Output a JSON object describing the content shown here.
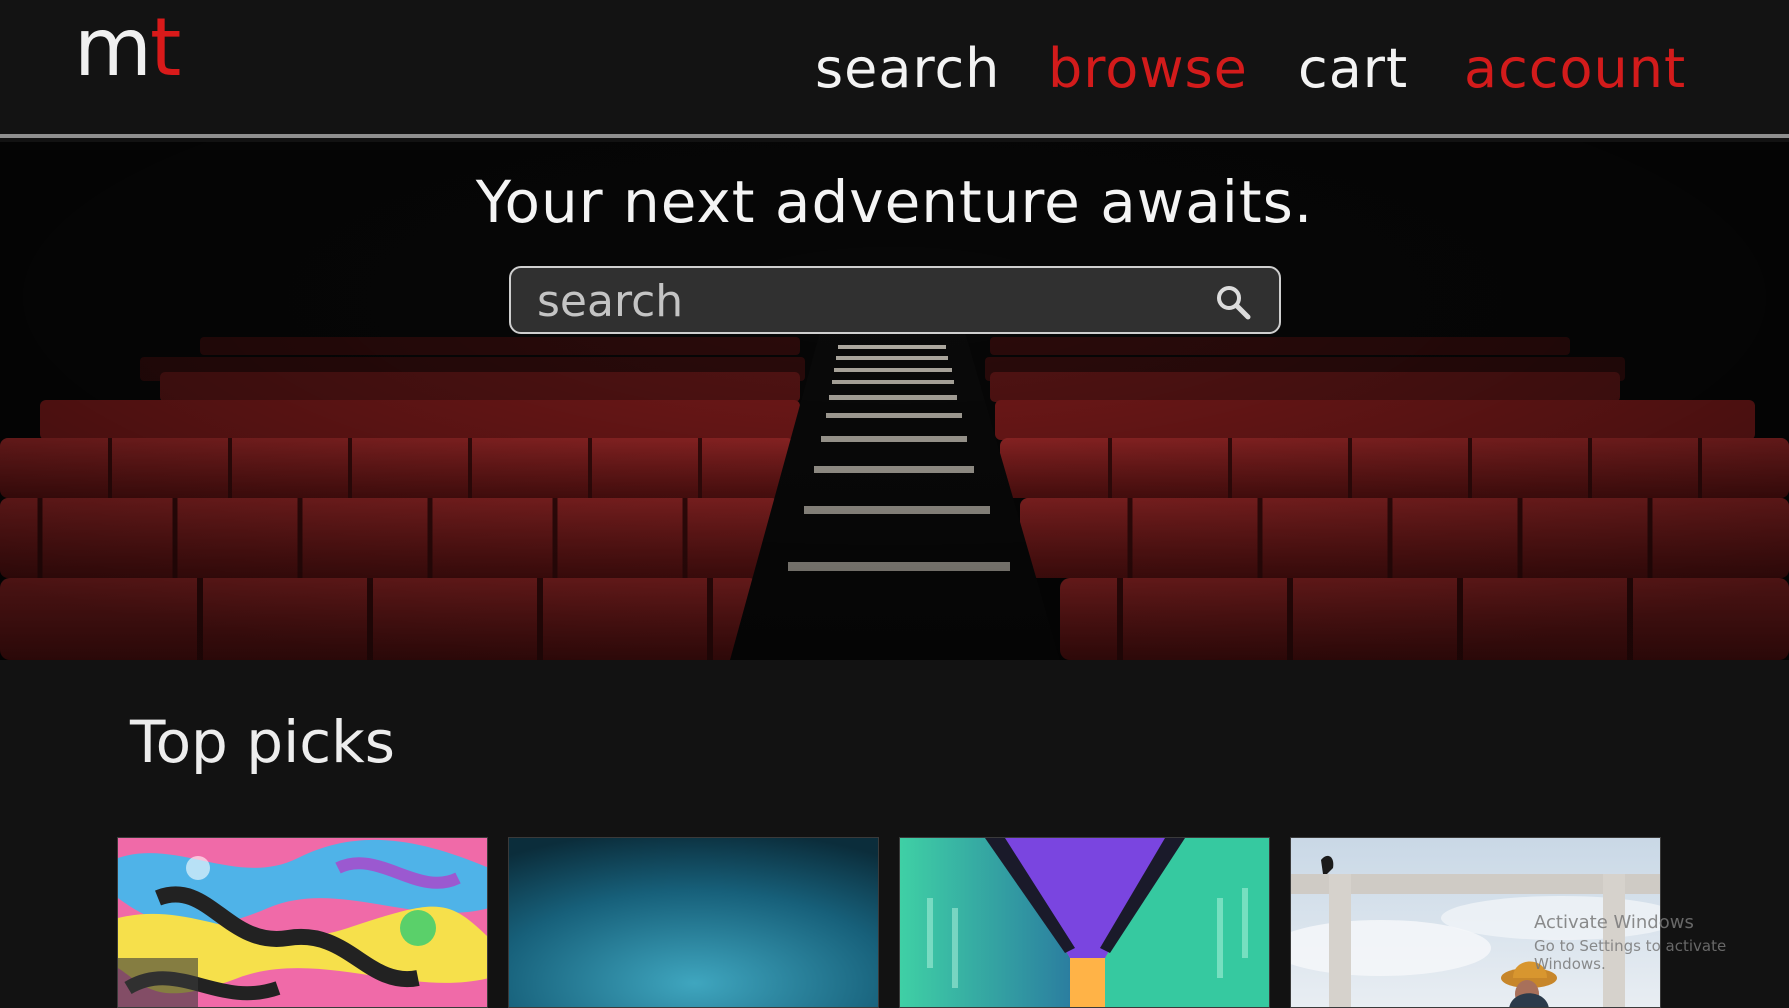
{
  "header": {
    "logo": {
      "m": "m",
      "t": "t"
    },
    "nav": [
      {
        "label": "search",
        "color": "#f3f3f3"
      },
      {
        "label": "browse",
        "color": "#d31b1b"
      },
      {
        "label": "cart",
        "color": "#f3f3f3"
      },
      {
        "label": "account",
        "color": "#d31b1b"
      }
    ]
  },
  "hero": {
    "title": "Your next adventure awaits.",
    "search": {
      "placeholder": "search",
      "value": "",
      "icon": "search-icon"
    },
    "image": "empty-cinema-red-seats"
  },
  "top_picks": {
    "title": "Top picks",
    "cards": [
      {
        "image": "colorful-graffiti"
      },
      {
        "image": "teal-gradient"
      },
      {
        "image": "neon-hallway"
      },
      {
        "image": "woman-orange-hat-concrete-frame-sky"
      }
    ]
  },
  "watermark": {
    "line1": "Activate Windows",
    "line2": "Go to Settings to activate Windows."
  },
  "colors": {
    "accent": "#d31b1b",
    "background": "#121212",
    "text": "#f3f3f3"
  }
}
